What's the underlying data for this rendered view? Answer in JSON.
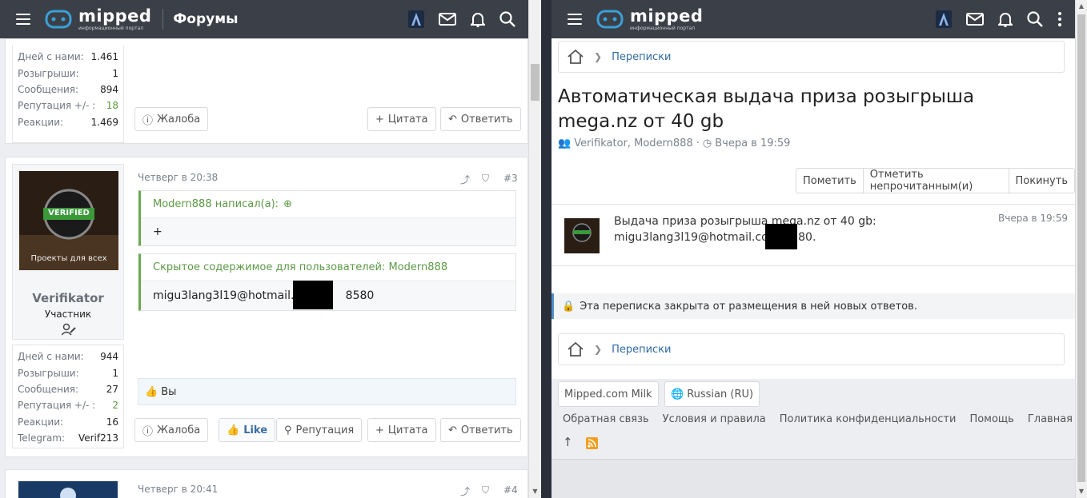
{
  "left": {
    "header": {
      "logo": "mipped",
      "logo_sub": "информационный портал",
      "section": "Форумы"
    },
    "post1": {
      "stats": [
        {
          "k": "Дней с нами:",
          "v": "1.461"
        },
        {
          "k": "Розыгрыши:",
          "v": "1"
        },
        {
          "k": "Сообщения:",
          "v": "894"
        },
        {
          "k": "Репутация +/- :",
          "v": "18"
        },
        {
          "k": "Реакции:",
          "v": "1.469"
        }
      ],
      "report": "Жалоба",
      "quote": "Цитата",
      "reply": "Ответить"
    },
    "post2": {
      "avatar_badge": "VERIFIED",
      "avatar_caption": "Проекты для всех",
      "username": "Verifikator",
      "role": "Участник",
      "date": "Четверг в 20:38",
      "number": "#3",
      "quote_head": "Modern888 написал(а):",
      "quote_body": "+",
      "hidden_head": "Скрытое содержимое для пользователей: Modern888",
      "hidden_body_a": "migu3lang3l19@hotmail.co",
      "hidden_body_b": "8580",
      "reaction": "Вы",
      "stats": [
        {
          "k": "Дней с нами:",
          "v": "944"
        },
        {
          "k": "Розыгрыши:",
          "v": "1"
        },
        {
          "k": "Сообщения:",
          "v": "27"
        },
        {
          "k": "Репутация +/- :",
          "v": "2"
        },
        {
          "k": "Реакции:",
          "v": "16"
        },
        {
          "k": "Telegram:",
          "v": "Verif213"
        }
      ],
      "report": "Жалоба",
      "like": "Like",
      "rep": "Репутация",
      "quote": "Цитата",
      "reply": "Ответить"
    },
    "post3": {
      "date": "Четверг в 20:41",
      "number": "#4"
    }
  },
  "right": {
    "header": {
      "logo": "mipped",
      "logo_sub": "информационный портал"
    },
    "breadcrumb": "Переписки",
    "title": "Автоматическая выдача приза розыгрыша mega.nz от 40 gb",
    "participants": "Verifikator, Modern888",
    "dot": "·",
    "time": "Вчера в 19:59",
    "actions": [
      "Пометить",
      "Отметить непрочитанным(и)",
      "Покинуть"
    ],
    "message": {
      "line1": "Выдача приза розыгрыша mega.nz от 40 gb:",
      "line2a": "migu3lang3l19@hotmail.com",
      "line2b": "8580.",
      "time": "Вчера в 19:59"
    },
    "notice": "Эта переписка закрыта от размещения в ней новых ответов.",
    "breadcrumb2": "Переписки",
    "footer": {
      "style": "Mipped.com Milk",
      "lang": "Russian (RU)",
      "links": [
        "Обратная связь",
        "Условия и правила",
        "Политика конфиденциальности",
        "Помощь",
        "Главная"
      ]
    }
  },
  "colors": {
    "header": "#3b3f47",
    "link": "#2f6aa3",
    "quote_green": "#5b9a44"
  }
}
